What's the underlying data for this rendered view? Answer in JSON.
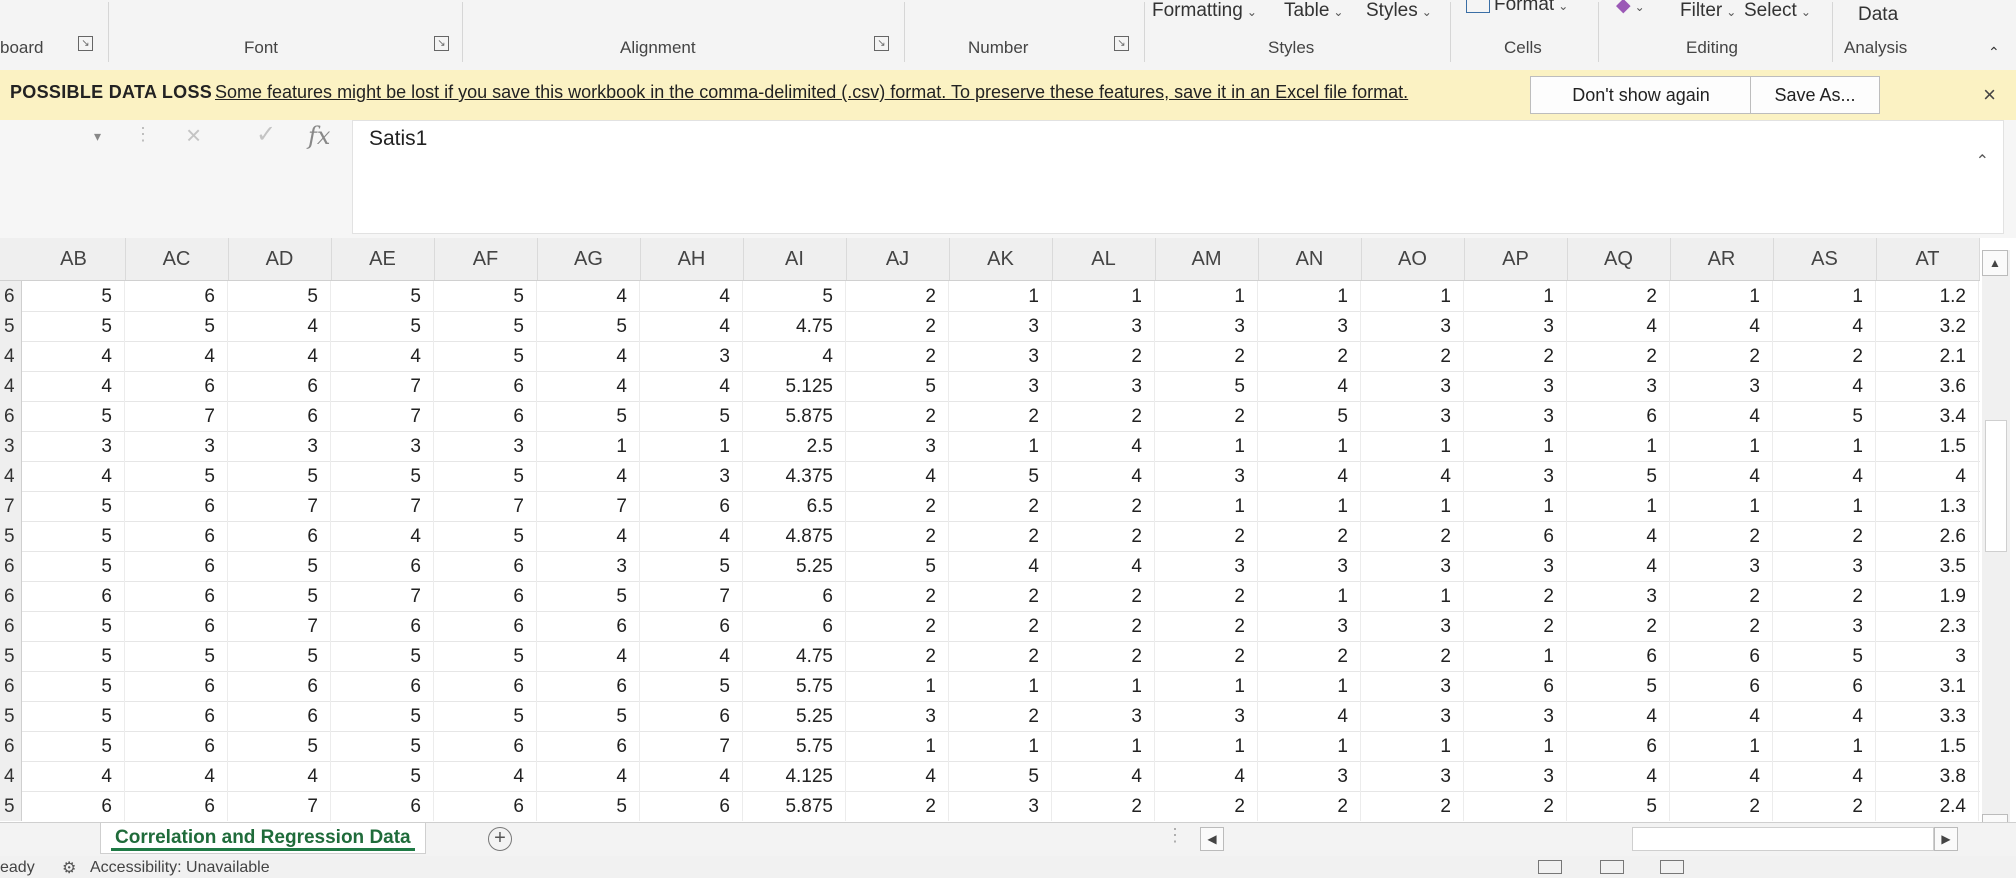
{
  "ribbon": {
    "groups": [
      {
        "label": "board"
      },
      {
        "label": "Font"
      },
      {
        "label": "Alignment"
      },
      {
        "label": "Number"
      },
      {
        "label": "Styles"
      },
      {
        "label": "Cells"
      },
      {
        "label": "Editing"
      },
      {
        "label": "Analysis"
      }
    ],
    "buttons": {
      "formatting": "Formatting",
      "table": "Table",
      "styles": "Styles",
      "format": "Format",
      "filter": "Filter",
      "select": "Select",
      "data": "Data"
    }
  },
  "message_bar": {
    "title": "POSSIBLE DATA LOSS",
    "text": "Some features might be lost if you save this workbook in the comma-delimited (.csv) format. To preserve these features, save it in an Excel file format.",
    "dont_show": "Don't show again",
    "save_as": "Save As...",
    "close": "×"
  },
  "formula_bar": {
    "cancel": "×",
    "enter": "✓",
    "fx": "fx",
    "value": "Satis1"
  },
  "grid": {
    "columns": [
      "AB",
      "AC",
      "AD",
      "AE",
      "AF",
      "AG",
      "AH",
      "AI",
      "AJ",
      "AK",
      "AL",
      "AM",
      "AN",
      "AO",
      "AP",
      "AQ",
      "AR",
      "AS",
      "AT"
    ],
    "rows": [
      {
        "n": "6",
        "c": [
          "5",
          "6",
          "5",
          "5",
          "5",
          "4",
          "4",
          "5",
          "2",
          "1",
          "1",
          "1",
          "1",
          "1",
          "1",
          "2",
          "1",
          "1",
          "1.2"
        ]
      },
      {
        "n": "5",
        "c": [
          "5",
          "5",
          "4",
          "5",
          "5",
          "5",
          "4",
          "4.75",
          "2",
          "3",
          "3",
          "3",
          "3",
          "3",
          "3",
          "4",
          "4",
          "4",
          "3.2"
        ]
      },
      {
        "n": "4",
        "c": [
          "4",
          "4",
          "4",
          "4",
          "5",
          "4",
          "3",
          "4",
          "2",
          "3",
          "2",
          "2",
          "2",
          "2",
          "2",
          "2",
          "2",
          "2",
          "2.1"
        ]
      },
      {
        "n": "4",
        "c": [
          "4",
          "6",
          "6",
          "7",
          "6",
          "4",
          "4",
          "5.125",
          "5",
          "3",
          "3",
          "5",
          "4",
          "3",
          "3",
          "3",
          "3",
          "4",
          "3.6"
        ]
      },
      {
        "n": "6",
        "c": [
          "5",
          "7",
          "6",
          "7",
          "6",
          "5",
          "5",
          "5.875",
          "2",
          "2",
          "2",
          "2",
          "5",
          "3",
          "3",
          "6",
          "4",
          "5",
          "3.4"
        ]
      },
      {
        "n": "3",
        "c": [
          "3",
          "3",
          "3",
          "3",
          "3",
          "1",
          "1",
          "2.5",
          "3",
          "1",
          "4",
          "1",
          "1",
          "1",
          "1",
          "1",
          "1",
          "1",
          "1.5"
        ]
      },
      {
        "n": "4",
        "c": [
          "4",
          "5",
          "5",
          "5",
          "5",
          "4",
          "3",
          "4.375",
          "4",
          "5",
          "4",
          "3",
          "4",
          "4",
          "3",
          "5",
          "4",
          "4",
          "4"
        ]
      },
      {
        "n": "7",
        "c": [
          "5",
          "6",
          "7",
          "7",
          "7",
          "7",
          "6",
          "6.5",
          "2",
          "2",
          "2",
          "1",
          "1",
          "1",
          "1",
          "1",
          "1",
          "1",
          "1.3"
        ]
      },
      {
        "n": "5",
        "c": [
          "5",
          "6",
          "6",
          "4",
          "5",
          "4",
          "4",
          "4.875",
          "2",
          "2",
          "2",
          "2",
          "2",
          "2",
          "6",
          "4",
          "2",
          "2",
          "2.6"
        ]
      },
      {
        "n": "6",
        "c": [
          "5",
          "6",
          "5",
          "6",
          "6",
          "3",
          "5",
          "5.25",
          "5",
          "4",
          "4",
          "3",
          "3",
          "3",
          "3",
          "4",
          "3",
          "3",
          "3.5"
        ]
      },
      {
        "n": "6",
        "c": [
          "6",
          "6",
          "5",
          "7",
          "6",
          "5",
          "7",
          "6",
          "2",
          "2",
          "2",
          "2",
          "1",
          "1",
          "2",
          "3",
          "2",
          "2",
          "1.9"
        ]
      },
      {
        "n": "6",
        "c": [
          "5",
          "6",
          "7",
          "6",
          "6",
          "6",
          "6",
          "6",
          "2",
          "2",
          "2",
          "2",
          "3",
          "3",
          "2",
          "2",
          "2",
          "3",
          "2.3"
        ]
      },
      {
        "n": "5",
        "c": [
          "5",
          "5",
          "5",
          "5",
          "5",
          "4",
          "4",
          "4.75",
          "2",
          "2",
          "2",
          "2",
          "2",
          "2",
          "1",
          "6",
          "6",
          "5",
          "3"
        ]
      },
      {
        "n": "6",
        "c": [
          "5",
          "6",
          "6",
          "6",
          "6",
          "6",
          "5",
          "5.75",
          "1",
          "1",
          "1",
          "1",
          "1",
          "3",
          "6",
          "5",
          "6",
          "6",
          "3.1"
        ]
      },
      {
        "n": "5",
        "c": [
          "5",
          "6",
          "6",
          "5",
          "5",
          "5",
          "6",
          "5.25",
          "3",
          "2",
          "3",
          "3",
          "4",
          "3",
          "3",
          "4",
          "4",
          "4",
          "3.3"
        ]
      },
      {
        "n": "6",
        "c": [
          "5",
          "6",
          "5",
          "5",
          "6",
          "6",
          "7",
          "5.75",
          "1",
          "1",
          "1",
          "1",
          "1",
          "1",
          "1",
          "6",
          "1",
          "1",
          "1.5"
        ]
      },
      {
        "n": "4",
        "c": [
          "4",
          "4",
          "4",
          "5",
          "4",
          "4",
          "4",
          "4.125",
          "4",
          "5",
          "4",
          "4",
          "3",
          "3",
          "3",
          "4",
          "4",
          "4",
          "3.8"
        ]
      },
      {
        "n": "5",
        "c": [
          "6",
          "6",
          "7",
          "6",
          "6",
          "5",
          "6",
          "5.875",
          "2",
          "3",
          "2",
          "2",
          "2",
          "2",
          "2",
          "5",
          "2",
          "2",
          "2.4"
        ]
      }
    ]
  },
  "sheet_tabs": {
    "active": "Correlation and Regression Data",
    "add": "+"
  },
  "status_bar": {
    "ready": "eady",
    "accessibility": "Accessibility: Unavailable"
  }
}
